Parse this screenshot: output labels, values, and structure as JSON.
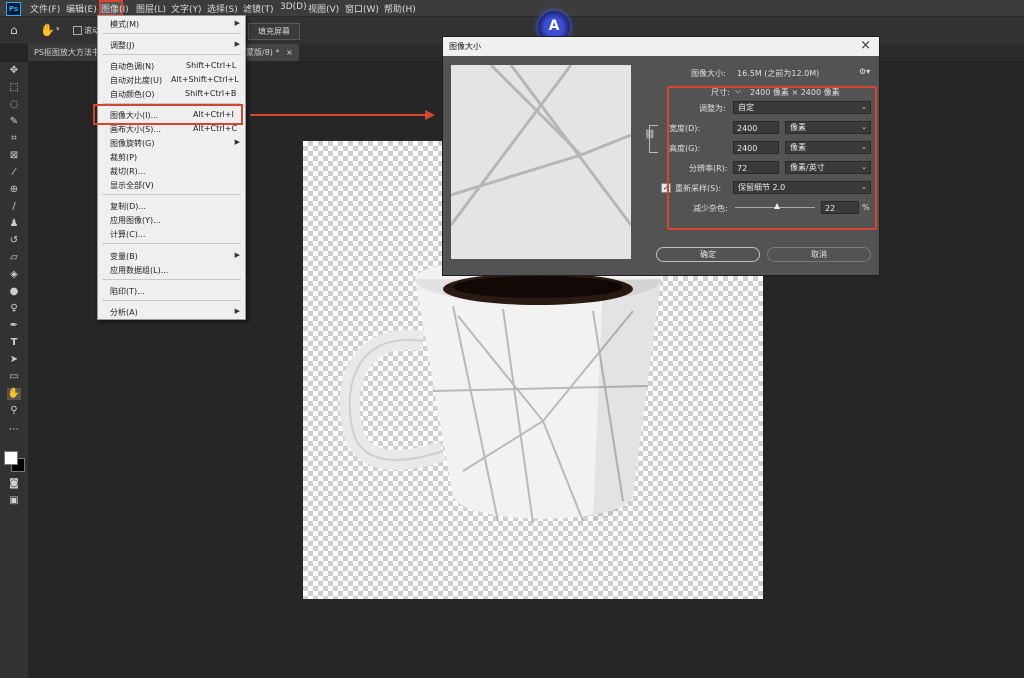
{
  "app": {
    "logo_text": "Ps"
  },
  "menubar": {
    "items": [
      "文件(F)",
      "编辑(E)",
      "图像(I)",
      "图层(L)",
      "文字(Y)",
      "选择(S)",
      "滤镜(T)",
      "3D(D)",
      "视图(V)",
      "窗口(W)",
      "帮助(H)"
    ]
  },
  "optionsbar": {
    "scroll_all_label": "滚动",
    "fill_screen_label": "填充屏幕"
  },
  "tabs": [
    {
      "label": "PS抠图放大方法书"
    },
    {
      "label": "蒙版/8) *"
    },
    {
      "close": "×"
    }
  ],
  "image_menu": {
    "items": [
      {
        "label": "模式(M)",
        "shortcut": "",
        "submenu": true
      },
      {
        "label": "调整(J)",
        "shortcut": "",
        "submenu": true
      },
      {
        "label": "自动色调(N)",
        "shortcut": "Shift+Ctrl+L",
        "submenu": false
      },
      {
        "label": "自动对比度(U)",
        "shortcut": "Alt+Shift+Ctrl+L",
        "submenu": false
      },
      {
        "label": "自动颜色(O)",
        "shortcut": "Shift+Ctrl+B",
        "submenu": false
      },
      {
        "label": "图像大小(I)...",
        "shortcut": "Alt+Ctrl+I",
        "submenu": false
      },
      {
        "label": "画布大小(S)...",
        "shortcut": "Alt+Ctrl+C",
        "submenu": false
      },
      {
        "label": "图像旋转(G)",
        "shortcut": "",
        "submenu": true
      },
      {
        "label": "裁剪(P)",
        "shortcut": "",
        "submenu": false
      },
      {
        "label": "裁切(R)...",
        "shortcut": "",
        "submenu": false
      },
      {
        "label": "显示全部(V)",
        "shortcut": "",
        "submenu": false
      },
      {
        "label": "复制(D)...",
        "shortcut": "",
        "submenu": false
      },
      {
        "label": "应用图像(Y)...",
        "shortcut": "",
        "submenu": false
      },
      {
        "label": "计算(C)...",
        "shortcut": "",
        "submenu": false
      },
      {
        "label": "变量(B)",
        "shortcut": "",
        "submenu": true
      },
      {
        "label": "应用数据组(L)...",
        "shortcut": "",
        "submenu": false
      },
      {
        "label": "陷印(T)...",
        "shortcut": "",
        "submenu": false
      },
      {
        "label": "分析(A)",
        "shortcut": "",
        "submenu": true
      }
    ]
  },
  "dialog": {
    "title": "图像大小",
    "close": "×",
    "image_size_label": "图像大小:",
    "image_size_value": "16.5M (之前为12.0M)",
    "dimensions_label": "尺寸:",
    "dimensions_value": "2400 像素 × 2400 像素",
    "fit_to_label": "调整为:",
    "fit_to_value": "自定",
    "width_label": "宽度(D):",
    "width_value": "2400",
    "width_unit": "像素",
    "height_label": "高度(G):",
    "height_value": "2400",
    "height_unit": "像素",
    "resolution_label": "分辨率(R):",
    "resolution_value": "72",
    "resolution_unit": "像素/英寸",
    "resample_label": "重新采样(S):",
    "resample_value": "保留细节 2.0",
    "noise_label": "减少杂色:",
    "noise_value": "22",
    "noise_percent": 22,
    "noise_unit": "%",
    "ok_label": "确定",
    "cancel_label": "取消"
  },
  "colors": {
    "accent_red": "#d9442c",
    "ps_blue": "#31a8ff"
  }
}
